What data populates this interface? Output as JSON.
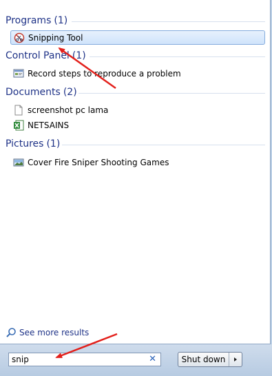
{
  "groups": {
    "programs": {
      "title": "Programs",
      "count": "(1)",
      "items": [
        {
          "label": "Snipping Tool",
          "icon": "scissors-icon"
        }
      ]
    },
    "control_panel": {
      "title": "Control Panel",
      "count": "(1)",
      "items": [
        {
          "label": "Record steps to reproduce a problem",
          "icon": "control-panel-icon"
        }
      ]
    },
    "documents": {
      "title": "Documents",
      "count": "(2)",
      "items": [
        {
          "label": "screenshot pc lama",
          "icon": "document-icon"
        },
        {
          "label": "NETSAINS",
          "icon": "excel-icon"
        }
      ]
    },
    "pictures": {
      "title": "Pictures",
      "count": "(1)",
      "items": [
        {
          "label": "Cover Fire Sniper Shooting Games",
          "icon": "picture-icon"
        }
      ]
    }
  },
  "see_more": {
    "label": "See more results",
    "icon": "search-icon"
  },
  "search": {
    "value": "snip",
    "clear_icon": "clear-icon"
  },
  "shutdown": {
    "label": "Shut down",
    "arrow_icon": "arrow-right-icon"
  },
  "colors": {
    "header_text": "#1e3287",
    "annotation_arrow": "#e3201b",
    "selection_border": "#84acdd"
  }
}
